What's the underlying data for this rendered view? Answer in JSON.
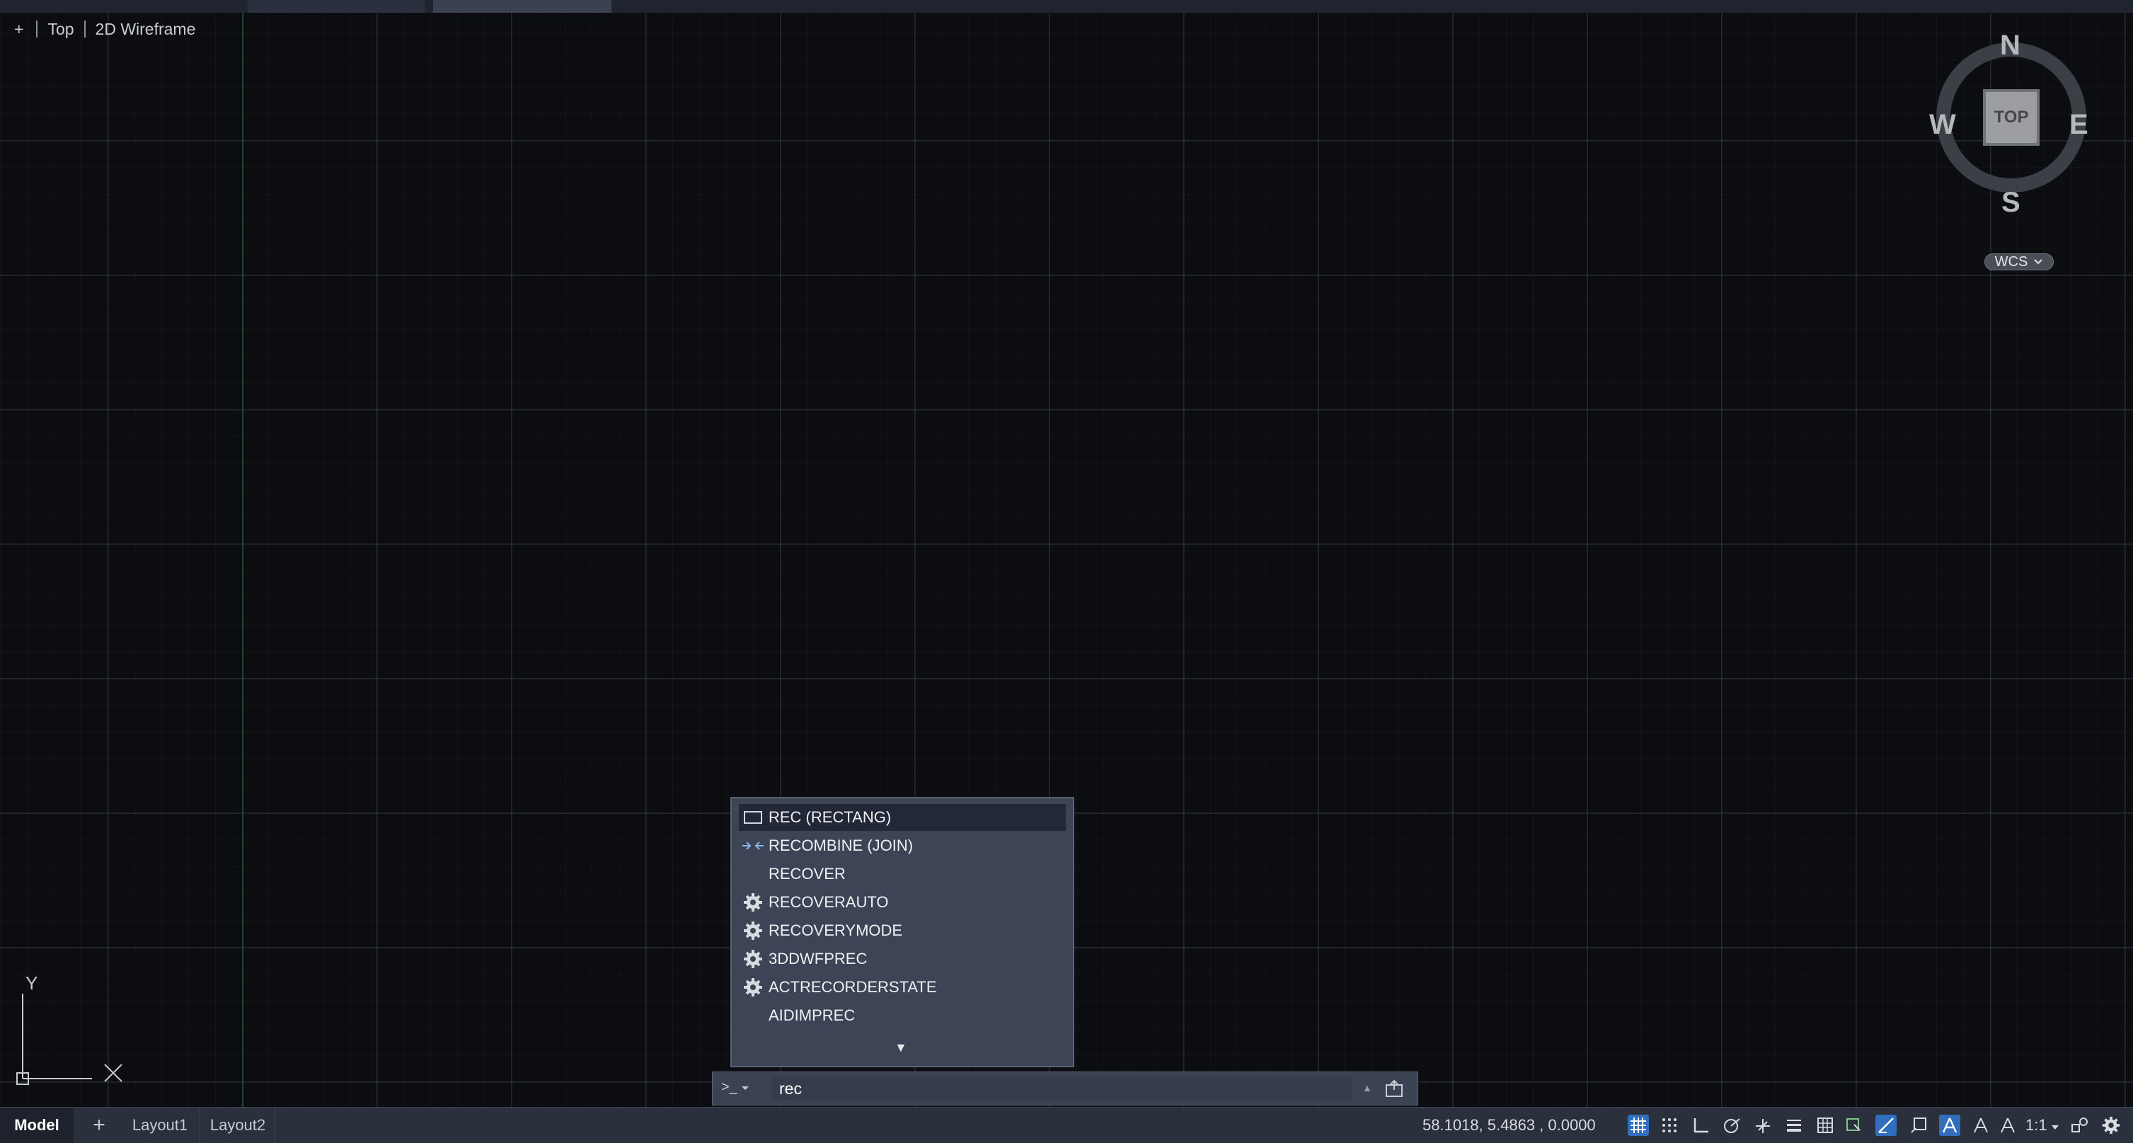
{
  "viewport": {
    "plus": "+",
    "view": "Top",
    "visual_style": "2D Wireframe"
  },
  "viewcube": {
    "face": "TOP",
    "north": "N",
    "south": "S",
    "east": "E",
    "west": "W",
    "coordinate_system": "WCS"
  },
  "ucs": {
    "y_label": "Y"
  },
  "autocomplete": {
    "items": [
      {
        "label": "REC (RECTANG)",
        "icon": "rectangle-icon",
        "selected": true
      },
      {
        "label": "RECOMBINE (JOIN)",
        "icon": "join-icon",
        "selected": false
      },
      {
        "label": "RECOVER",
        "icon": "",
        "selected": false
      },
      {
        "label": "RECOVERAUTO",
        "icon": "gear-icon",
        "selected": false
      },
      {
        "label": "RECOVERYMODE",
        "icon": "gear-icon",
        "selected": false
      },
      {
        "label": "3DDWFPREC",
        "icon": "gear-icon",
        "selected": false
      },
      {
        "label": "ACTRECORDERSTATE",
        "icon": "gear-icon",
        "selected": false
      },
      {
        "label": "AIDIMPREC",
        "icon": "",
        "selected": false
      }
    ],
    "more": "▼"
  },
  "command_line": {
    "prompt": ">_",
    "value": "rec"
  },
  "layout_tabs": {
    "model": "Model",
    "add": "+",
    "layout1": "Layout1",
    "layout2": "Layout2"
  },
  "status_bar": {
    "coordinates": "58.1018,  5.4863  , 0.0000",
    "annotation_scale": "1:1"
  },
  "colors": {
    "canvas": "#0c0d11",
    "accent": "#2f6fbd",
    "dropdown": "#3c4456"
  }
}
